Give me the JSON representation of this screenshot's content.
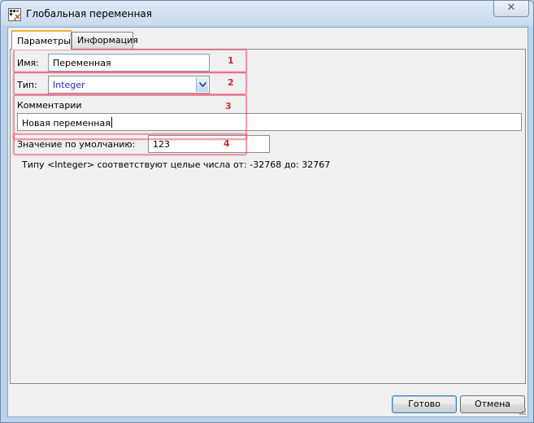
{
  "window": {
    "title": "Глобальная переменная",
    "close_symbol": "✕"
  },
  "tabs": [
    {
      "label": "Параметры",
      "active": true
    },
    {
      "label": "Информация",
      "active": false
    }
  ],
  "form": {
    "name_label": "Имя:",
    "name_value": "Переменная",
    "type_label": "Тип:",
    "type_value": "Integer",
    "comment_label": "Комментарии",
    "comment_value": "Новая переменная",
    "default_label": "Значение по умолчанию:",
    "default_value": "123",
    "info_text": "Типу <Integer> соответствуют целые числа от: -32768 до: 32767"
  },
  "annotations": [
    "1",
    "2",
    "3",
    "4"
  ],
  "buttons": {
    "ok_label": "Готово",
    "cancel_label": "Отмена"
  },
  "colors": {
    "annotation": "#d32a2a",
    "highlight": "#ec506e",
    "type_text": "#1b2fb5",
    "active_tab_accent": "#f2b233"
  },
  "icons": {
    "app": "variable-icon",
    "close": "close-icon",
    "dropdown": "chevron-down-icon",
    "resize": "resize-grip-icon"
  }
}
